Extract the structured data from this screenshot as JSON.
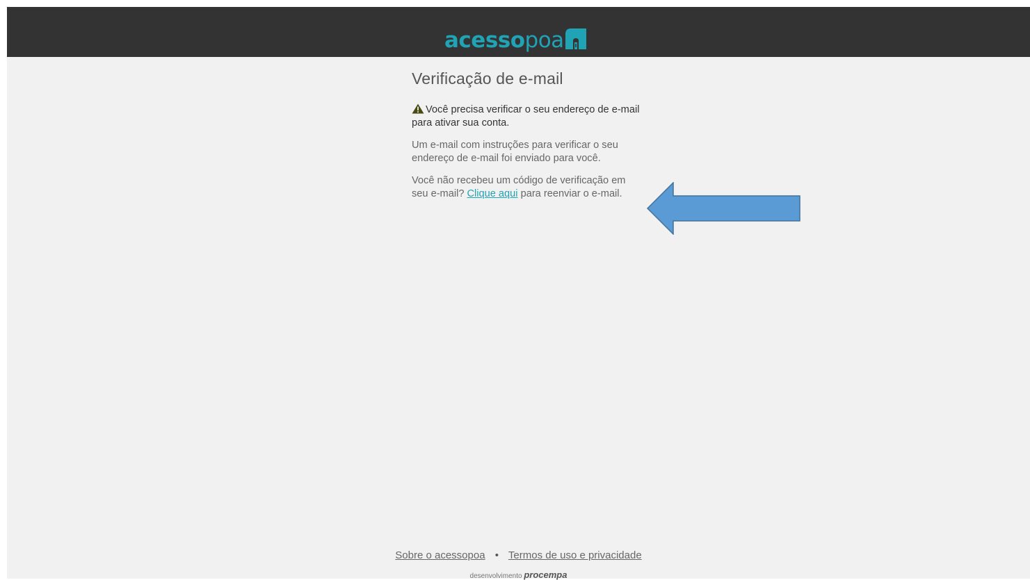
{
  "header": {
    "logo_bold": "acesso",
    "logo_light": "poa"
  },
  "main": {
    "title": "Verificação de e-mail",
    "warning_text": "Você precisa verificar o seu endereço de e-mail para ativar sua conta.",
    "instructions": "Um e-mail com instruções para verificar o seu endereço de e-mail foi enviado para você.",
    "resend_before": "Você não recebeu um código de verificação em seu e-mail?",
    "resend_link": "Clique aqui",
    "resend_after": "para reenviar o e-mail."
  },
  "footer": {
    "about_link": "Sobre o acessopoa",
    "separator": "•",
    "terms_link": "Termos de uso e privacidade",
    "credit_prefix": "desenvolvimento",
    "credit_brand": "procempa"
  },
  "colors": {
    "brand_teal": "#1fa3b5",
    "header_bg": "#333333",
    "page_bg": "#f1f1f1",
    "arrow_fill": "#5b9bd5",
    "arrow_stroke": "#41719c",
    "warning_icon": "#4a4a10"
  },
  "icons": {
    "logo_mark": "door-icon",
    "warning": "warning-triangle-icon",
    "annotation": "left-arrow-annotation"
  }
}
